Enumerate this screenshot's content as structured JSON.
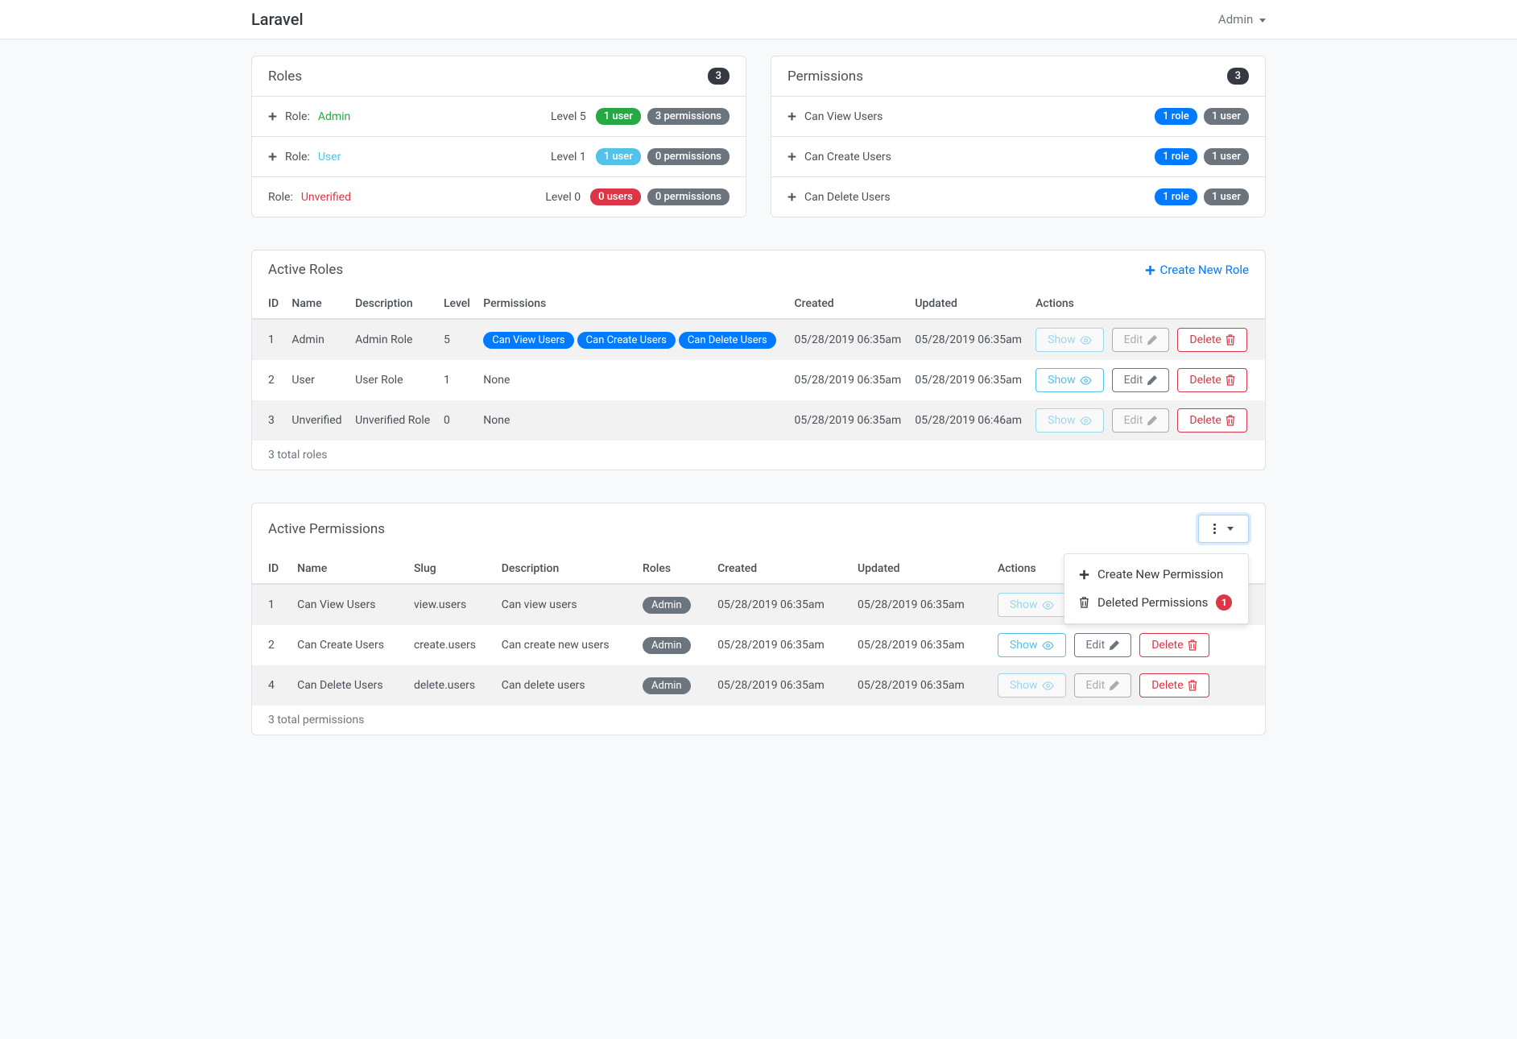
{
  "navbar": {
    "brand": "Laravel",
    "admin": "Admin"
  },
  "roles_card": {
    "title": "Roles",
    "count": "3",
    "items": [
      {
        "prefix": "Role:",
        "name": "Admin",
        "color": "success",
        "has_plus": true,
        "level": "Level 5",
        "users": "1 user",
        "users_color": "success",
        "perms": "3 permissions"
      },
      {
        "prefix": "Role:",
        "name": "User",
        "color": "info",
        "has_plus": true,
        "level": "Level 1",
        "users": "1 user",
        "users_color": "info",
        "perms": "0 permissions"
      },
      {
        "prefix": "Role:",
        "name": "Unverified",
        "color": "danger",
        "has_plus": false,
        "level": "Level 0",
        "users": "0 users",
        "users_color": "danger",
        "perms": "0 permissions"
      }
    ]
  },
  "perms_card": {
    "title": "Permissions",
    "count": "3",
    "items": [
      {
        "name": "Can View Users",
        "roles": "1 role",
        "users": "1 user"
      },
      {
        "name": "Can Create Users",
        "roles": "1 role",
        "users": "1 user"
      },
      {
        "name": "Can Delete Users",
        "roles": "1 role",
        "users": "1 user"
      }
    ]
  },
  "active_roles": {
    "title": "Active Roles",
    "create_link": "Create New Role",
    "headers": [
      "ID",
      "Name",
      "Description",
      "Level",
      "Permissions",
      "Created",
      "Updated",
      "Actions"
    ],
    "rows": [
      {
        "id": "1",
        "name": "Admin",
        "desc": "Admin Role",
        "level": "5",
        "perms": [
          "Can View Users",
          "Can Create Users",
          "Can Delete Users"
        ],
        "none": false,
        "created": "05/28/2019 06:35am",
        "updated": "05/28/2019 06:35am",
        "disabled": true
      },
      {
        "id": "2",
        "name": "User",
        "desc": "User Role",
        "level": "1",
        "perms": [],
        "none": true,
        "created": "05/28/2019 06:35am",
        "updated": "05/28/2019 06:35am",
        "disabled": false
      },
      {
        "id": "3",
        "name": "Unverified",
        "desc": "Unverified Role",
        "level": "0",
        "perms": [],
        "none": true,
        "created": "05/28/2019 06:35am",
        "updated": "05/28/2019 06:46am",
        "disabled": true
      }
    ],
    "footer": "3 total roles",
    "btn_show": "Show",
    "btn_edit": "Edit",
    "btn_delete": "Delete",
    "none_text": "None"
  },
  "active_perms": {
    "title": "Active Permissions",
    "headers": [
      "ID",
      "Name",
      "Slug",
      "Description",
      "Roles",
      "Created",
      "Updated",
      "Actions"
    ],
    "rows": [
      {
        "id": "1",
        "name": "Can View Users",
        "slug": "view.users",
        "desc": "Can view users",
        "role": "Admin",
        "created": "05/28/2019 06:35am",
        "updated": "05/28/2019 06:35am",
        "disabled": true
      },
      {
        "id": "2",
        "name": "Can Create Users",
        "slug": "create.users",
        "desc": "Can create new users",
        "role": "Admin",
        "created": "05/28/2019 06:35am",
        "updated": "05/28/2019 06:35am",
        "disabled": false
      },
      {
        "id": "4",
        "name": "Can Delete Users",
        "slug": "delete.users",
        "desc": "Can delete users",
        "role": "Admin",
        "created": "05/28/2019 06:35am",
        "updated": "05/28/2019 06:35am",
        "disabled": true
      }
    ],
    "footer": "3 total permissions",
    "dropdown": {
      "create": "Create New Permission",
      "deleted": "Deleted Permissions",
      "deleted_count": "1"
    }
  }
}
